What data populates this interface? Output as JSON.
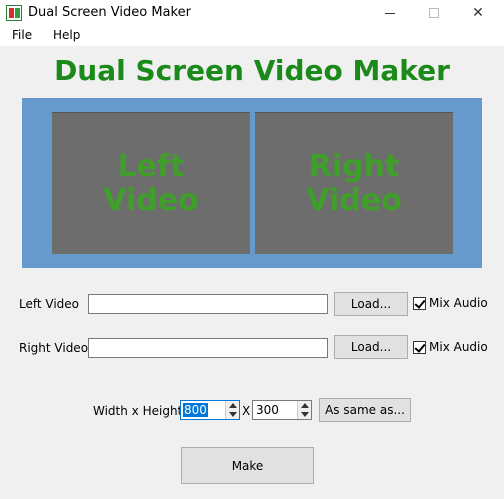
{
  "window": {
    "title": "Dual Screen Video Maker",
    "minimize_glyph": "—",
    "close_glyph": "✕"
  },
  "menu": [
    "File",
    "Help"
  ],
  "heading": "Dual Screen Video Maker",
  "preview": {
    "left_text": "Left Video",
    "right_text": "Right Video"
  },
  "left_video": {
    "label": "Left Video",
    "value": "",
    "load_label": "Load...",
    "mix_label": "Mix Audio",
    "mix_checked": true
  },
  "right_video": {
    "label": "Right Video",
    "value": "",
    "load_label": "Load...",
    "mix_label": "Mix Audio",
    "mix_checked": true
  },
  "size": {
    "label": "Width x Height",
    "width": "800",
    "separator": "X",
    "height": "300",
    "same_as_label": "As same as..."
  },
  "make_label": "Make",
  "colors": {
    "heading": "#1b8a1b",
    "preview_bg": "#6699cc",
    "pane_bg": "#6d6d6d",
    "pane_text": "#3f9f2a"
  }
}
